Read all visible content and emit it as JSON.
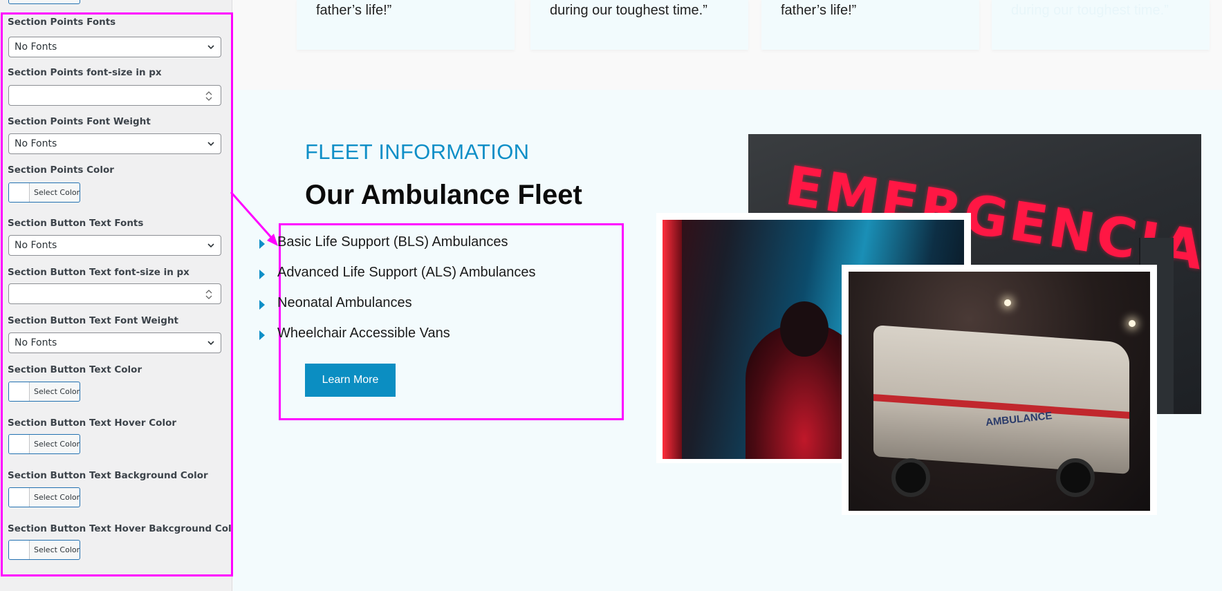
{
  "panel": {
    "fields": [
      {
        "label": "Section Points Fonts",
        "type": "select",
        "value": "No Fonts"
      },
      {
        "label": "Section Points font-size in px",
        "type": "number",
        "value": ""
      },
      {
        "label": "Section Points Font Weight",
        "type": "select",
        "value": "No Fonts"
      },
      {
        "label": "Section Points Color",
        "type": "color",
        "button": "Select Color"
      },
      {
        "label": "Section Button Text Fonts",
        "type": "select",
        "value": "No Fonts"
      },
      {
        "label": "Section Button Text font-size in px",
        "type": "number",
        "value": ""
      },
      {
        "label": "Section Button Text Font Weight",
        "type": "select",
        "value": "No Fonts"
      },
      {
        "label": "Section Button Text Color",
        "type": "color",
        "button": "Select Color"
      },
      {
        "label": "Section Button Text Hover Color",
        "type": "color",
        "button": "Select Color"
      },
      {
        "label": "Section Button Text Background Color",
        "type": "color",
        "button": "Select Color"
      },
      {
        "label": "Section Button Text Hover Bakcground Color",
        "type": "color",
        "button": "Select Color"
      }
    ]
  },
  "testimonials": [
    {
      "quote": "father’s life!”"
    },
    {
      "quote": "during our toughest time.”"
    },
    {
      "quote": "father’s life!”"
    },
    {
      "quote": "during our toughest time.”"
    }
  ],
  "fleet": {
    "eyebrow": "FLEET INFORMATION",
    "heading": "Our Ambulance Fleet",
    "items": [
      "Basic Life Support (BLS) Ambulances",
      "Advanced Life Support (ALS) Ambulances",
      "Neonatal Ambulances",
      "Wheelchair Accessible Vans"
    ],
    "button": "Learn More"
  },
  "photos": {
    "sign_text": "EMERGENCIA",
    "van_text": "AMBULANCE"
  },
  "colors": {
    "accent": "#0f8fc7",
    "button_bg": "#0b8ec2",
    "highlight": "#ff00ff",
    "wp_blue": "#2271b1"
  },
  "icons": {
    "select_arrow": "chevron-down-icon",
    "number_spinner": "spinner-arrows-icon",
    "list_bullet": "triangle-right-icon",
    "connector": "arrow-icon"
  }
}
